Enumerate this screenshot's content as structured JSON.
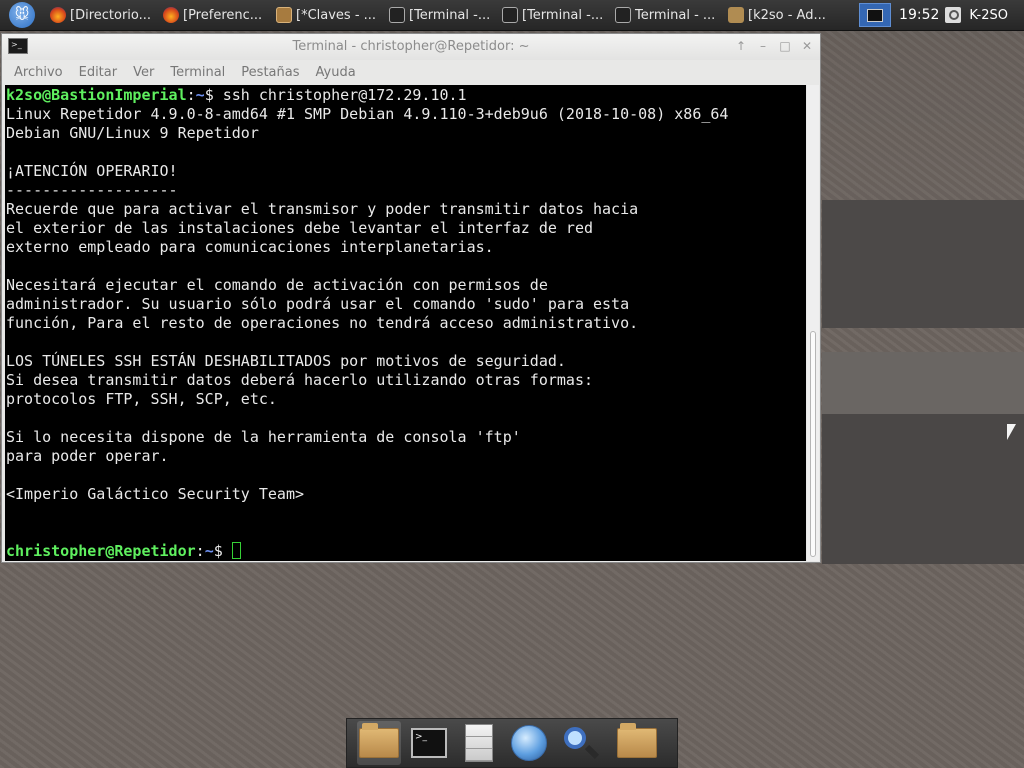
{
  "taskbar": {
    "tasks": [
      {
        "label": "[Directorio...",
        "icon": "firefox-icon"
      },
      {
        "label": "[Preferenc...",
        "icon": "firefox-icon"
      },
      {
        "label": "[*Claves - ...",
        "icon": "text-editor-icon"
      },
      {
        "label": "[Terminal -...",
        "icon": "terminal-icon"
      },
      {
        "label": "[Terminal -...",
        "icon": "terminal-icon"
      },
      {
        "label": "Terminal - ...",
        "icon": "terminal-icon"
      },
      {
        "label": "[k2so - Ad...",
        "icon": "file-manager-icon"
      }
    ],
    "clock": "19:52",
    "user": "K-2SO"
  },
  "window": {
    "title": "Terminal - christopher@Repetidor: ~",
    "menu": [
      "Archivo",
      "Editar",
      "Ver",
      "Terminal",
      "Pestañas",
      "Ayuda"
    ]
  },
  "terminal": {
    "first_prompt": {
      "user": "k2so@BastionImperial",
      "sep": ":",
      "path": "~",
      "symbol": "$ ",
      "command": "ssh christopher@172.29.10.1"
    },
    "output": [
      "Linux Repetidor 4.9.0-8-amd64 #1 SMP Debian 4.9.110-3+deb9u6 (2018-10-08) x86_64",
      "Debian GNU/Linux 9 Repetidor",
      "",
      "¡ATENCIÓN OPERARIO!",
      "-------------------",
      "Recuerde que para activar el transmisor y poder transmitir datos hacia",
      "el exterior de las instalaciones debe levantar el interfaz de red",
      "externo empleado para comunicaciones interplanetarias.",
      "",
      "Necesitará ejecutar el comando de activación con permisos de",
      "administrador. Su usuario sólo podrá usar el comando 'sudo' para esta",
      "función, Para el resto de operaciones no tendrá acceso administrativo.",
      "",
      "LOS TÚNELES SSH ESTÁN DESHABILITADOS por motivos de seguridad.",
      "Si desea transmitir datos deberá hacerlo utilizando otras formas:",
      "protocolos FTP, SSH, SCP, etc.",
      "",
      "Si lo necesita dispone de la herramienta de consola 'ftp'",
      "para poder operar.",
      "",
      "<Imperio Galáctico Security Team>",
      "",
      ""
    ],
    "last_prompt": {
      "user": "christopher@Repetidor",
      "sep": ":",
      "path": "~",
      "symbol": "$ "
    }
  },
  "dock": [
    "home-folder-icon",
    "terminal-icon",
    "file-cabinet-icon",
    "web-browser-icon",
    "search-icon",
    "folder-icon"
  ]
}
